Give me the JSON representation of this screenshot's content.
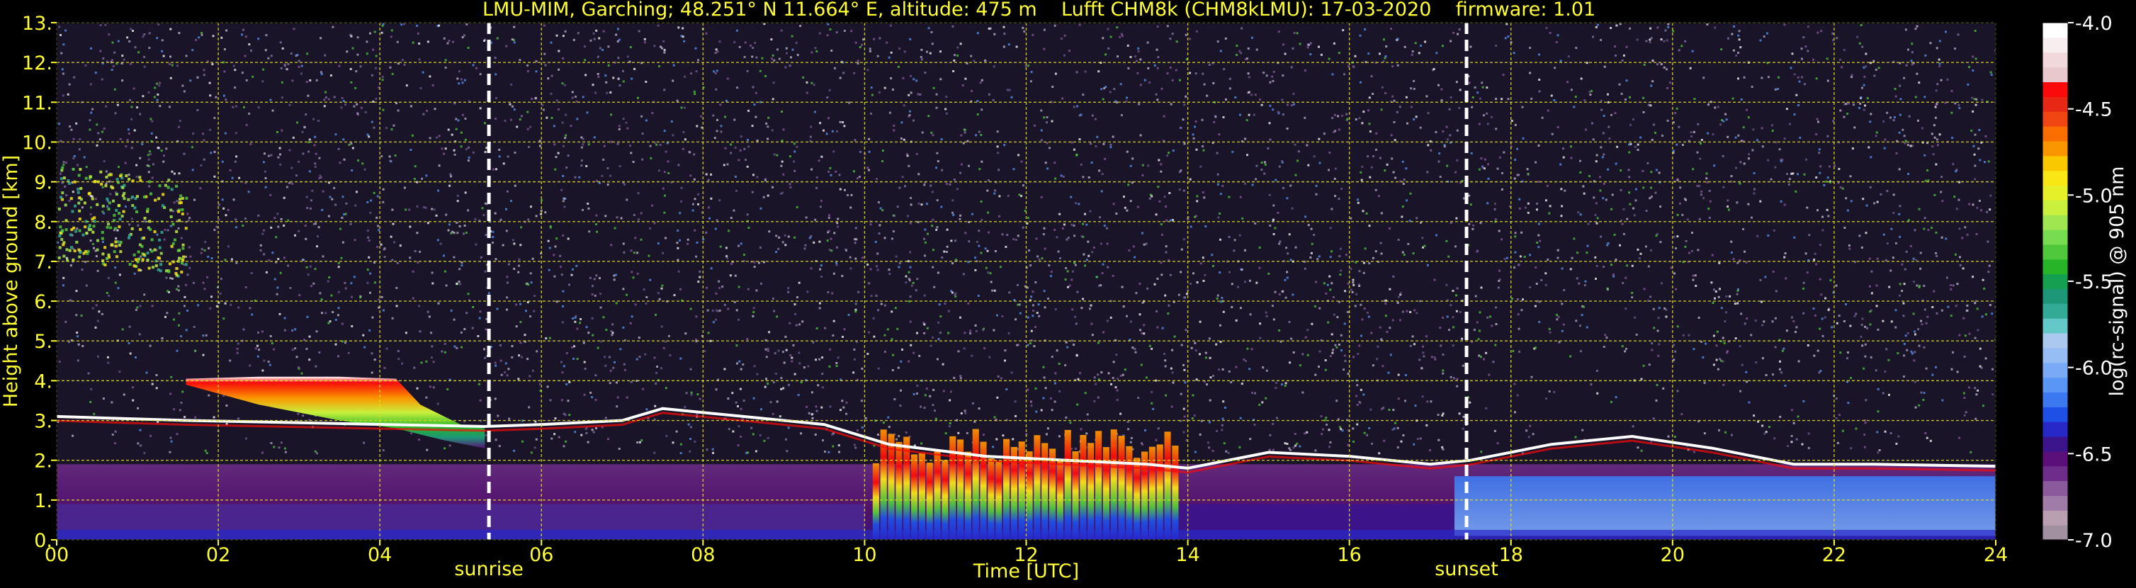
{
  "title": "LMU-MIM, Garching; 48.251° N 11.664° E, altitude: 475 m    Lufft CHM8k (CHM8kLMU): 17-03-2020    firmware: 1.01",
  "colors": {
    "background": "#000000",
    "text": "#ffff33",
    "grid": "#e0e020",
    "colorbar_text": "#ffffff",
    "event_lines": "#ffffff"
  },
  "chart_data": {
    "type": "heatmap",
    "title": "LMU-MIM, Garching; 48.251° N 11.664° E, altitude: 475 m    Lufft CHM8k (CHM8kLMU): 17-03-2020    firmware: 1.01",
    "xlabel": "Time [UTC]",
    "ylabel": "Height above ground [km]",
    "xlim": [
      0,
      24
    ],
    "ylim": [
      0,
      13
    ],
    "x_ticks": [
      "00",
      "02",
      "04",
      "06",
      "08",
      "10",
      "12",
      "14",
      "16",
      "18",
      "20",
      "22",
      "24"
    ],
    "y_ticks": [
      "0.",
      "1.",
      "2.",
      "3.",
      "4.",
      "5.",
      "6.",
      "7.",
      "8.",
      "9.",
      "10.",
      "11.",
      "12.",
      "13."
    ],
    "grid": true,
    "events": [
      {
        "label": "sunrise",
        "time": 5.35
      },
      {
        "label": "sunset",
        "time": 17.45
      }
    ],
    "colorbar": {
      "label": "log(rc-signal) @ 905 nm",
      "range": [
        -7.0,
        -4.0
      ],
      "ticks": [
        "-4.0",
        "-4.5",
        "-5.0",
        "-5.5",
        "-6.0",
        "-6.5",
        "-7.0"
      ],
      "colors": [
        "#a090a0",
        "#b8a0b0",
        "#a07ca8",
        "#8a5a9c",
        "#6e2d8a",
        "#5a1078",
        "#3c148c",
        "#2828c8",
        "#1e50e6",
        "#3c78f0",
        "#5a96f5",
        "#7aaaf5",
        "#96bef5",
        "#aac8f0",
        "#64c8c8",
        "#32aa96",
        "#1e9678",
        "#14a050",
        "#28b428",
        "#50c83c",
        "#78dc50",
        "#a0e650",
        "#c8f03c",
        "#e6f028",
        "#fae614",
        "#fac800",
        "#fa9600",
        "#fa6e00",
        "#f04614",
        "#e62814",
        "#fa0a0a",
        "#e8c8cc",
        "#f0d8dc",
        "#f8eef0",
        "#ffffff"
      ]
    },
    "layers": [
      {
        "name": "noise",
        "t": [
          0,
          24
        ],
        "h": [
          0,
          13
        ]
      },
      {
        "name": "aerosol-layer",
        "t": [
          0,
          24
        ],
        "h": [
          0,
          1.9
        ]
      },
      {
        "name": "cloud-4km",
        "t": [
          1.6,
          5.3
        ],
        "h": [
          2.3,
          4.1
        ]
      },
      {
        "name": "cirrus",
        "t": [
          0,
          1.6
        ],
        "h": [
          7.0,
          9.5
        ]
      },
      {
        "name": "convective-clouds",
        "t": [
          10.1,
          13.9
        ],
        "h": [
          0,
          2.8
        ]
      },
      {
        "name": "cloud-top-line",
        "t": [
          5.3,
          24
        ],
        "h": [
          1.7,
          3.0
        ]
      }
    ]
  }
}
